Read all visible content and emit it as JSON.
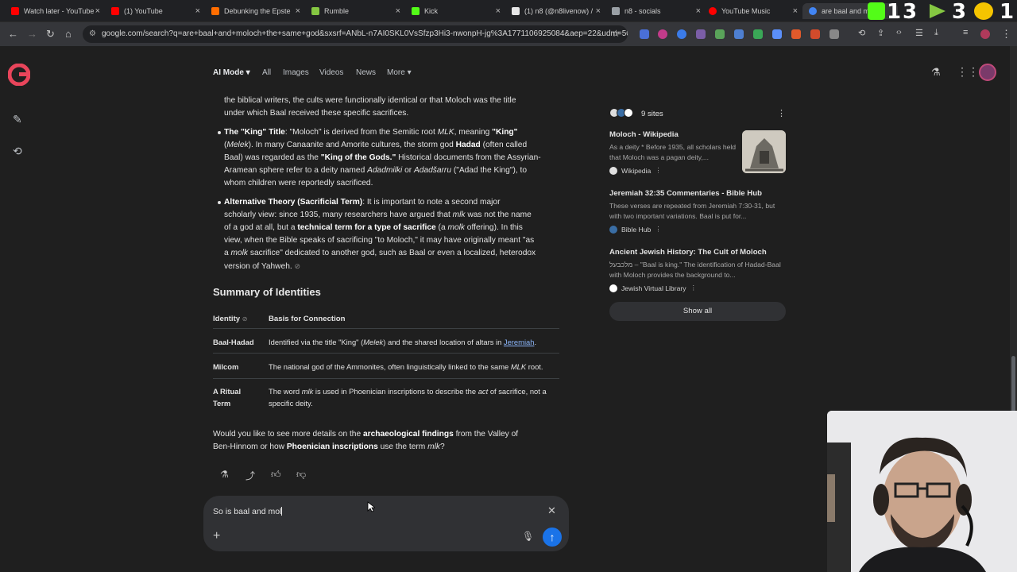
{
  "browser": {
    "tabs": [
      {
        "title": "Watch later - YouTube",
        "color": "#ff0000"
      },
      {
        "title": "(1) YouTube",
        "color": "#ff0000"
      },
      {
        "title": "Debunking the Epste",
        "color": "#ff6d00"
      },
      {
        "title": "Rumble",
        "color": "#85c742"
      },
      {
        "title": "Kick",
        "color": "#53fc18"
      },
      {
        "title": "(1) n8 (@n8livenow) /",
        "color": "#e7e7e7"
      },
      {
        "title": "n8 - socials",
        "color": "#9aa0a6"
      },
      {
        "title": "YouTube Music",
        "color": "#ff0000"
      },
      {
        "title": "are baal and mo",
        "color": "#4285f4"
      }
    ],
    "url": "google.com/search?q=are+baal+and+moloch+the+same+god&sxsrf=ANbL-n7AI0SKL0VsSfzp3Hi3-nwonpH-jg%3A1771106925084&aep=22&udm=50...",
    "overlay_badges": [
      "1",
      "3",
      "3",
      "1"
    ]
  },
  "nav": {
    "ai_mode": "AI Mode",
    "items": [
      "All",
      "Images",
      "Videos",
      "News",
      "More"
    ]
  },
  "answer": {
    "intro_line1": "the biblical writers, the cults were functionally identical or that Moloch was the title",
    "intro_line2": "under which Baal received these specific sacrifices.",
    "bullet1": {
      "title": "The \"King\" Title",
      "l1a": ": \"Moloch\" is derived from the Semitic root ",
      "mlk": "MLK",
      "l1b": ", meaning ",
      "king": "\"King\"",
      "l2a": "(",
      "melek": "Melek",
      "l2b": "). In many Canaanite and Amorite cultures, the storm god ",
      "hadad": "Hadad",
      "l2c": " (often called",
      "l3a": "Baal) was regarded as the ",
      "kog": "\"King of the Gods.\"",
      "l3b": " Historical documents from the Assyrian-",
      "l4a": "Aramean sphere refer to a deity named ",
      "adad1": "Adadmilki",
      "l4b": " or ",
      "adad2": "Adadšarru",
      "l4c": " (\"Adad the King\"), to",
      "l5": "whom children were reportedly sacrificed."
    },
    "bullet2": {
      "title": "Alternative Theory (Sacrificial Term)",
      "l1": ": It is important to note a second major",
      "l2a": "scholarly view: since 1935, many researchers have argued that ",
      "mlk": "mlk",
      "l2b": " was not the name",
      "l3a": "of a god at all, but a ",
      "tech": "technical term for a type of sacrifice",
      "l3b": " (a ",
      "molk": "molk",
      "l3c": " offering). In this",
      "l4": "view, when the Bible speaks of sacrificing \"to Moloch,\" it may have originally meant \"as",
      "l5a": "a ",
      "molk2": "molk",
      "l5b": " sacrifice\" dedicated to another god, such as Baal or even a localized, heterodox",
      "l6": "version of Yahweh."
    },
    "summary_heading": "Summary of Identities",
    "table": {
      "headers": [
        "Identity",
        "Basis for Connection"
      ],
      "rows": [
        {
          "identity": "Baal-Hadad",
          "basis_a": "Identified via the title \"King\" (",
          "basis_em": "Melek",
          "basis_b": ") and the shared location of altars in ",
          "basis_link": "Jeremiah",
          "basis_c": "."
        },
        {
          "identity": "Milcom",
          "basis_a": "The national god of the Ammonites, often linguistically linked to the same ",
          "basis_em": "MLK",
          "basis_b": " root."
        },
        {
          "identity_l1": "A Ritual",
          "identity_l2": "Term",
          "basis_a": "The word ",
          "basis_em": "mlk",
          "basis_b": " is used in Phoenician inscriptions to describe the ",
          "basis_em2": "act",
          "basis_c": " of sacrifice, not a",
          "basis_l2": "specific deity."
        }
      ]
    },
    "followup": {
      "a": "Would you like to see more details on the ",
      "b": "archaeological findings",
      "c": " from the Valley of",
      "d": "Ben-Hinnom or how ",
      "e": "Phoenician inscriptions",
      "f": " use the term ",
      "g": "mlk",
      "h": "?"
    }
  },
  "input": {
    "value": "So is baal and mol"
  },
  "sources": {
    "count_label": "9 sites",
    "items": [
      {
        "title": "Moloch - Wikipedia",
        "snippet": "As a deity * Before 1935, all scholars held that Moloch was a pagan deity,...",
        "site": "Wikipedia"
      },
      {
        "title": "Jeremiah 32:35 Commentaries - Bible Hub",
        "snippet": "These verses are repeated from Jeremiah 7:30-31, but with two important variations. Baal is put for...",
        "site": "Bible Hub"
      },
      {
        "title": "Ancient Jewish History: The Cult of Moloch",
        "snippet": "מלכבעל – \"Baal is king.\" The identification of Hadad-Baal with Moloch provides the background to...",
        "site": "Jewish Virtual Library"
      }
    ],
    "show_all": "Show all"
  }
}
